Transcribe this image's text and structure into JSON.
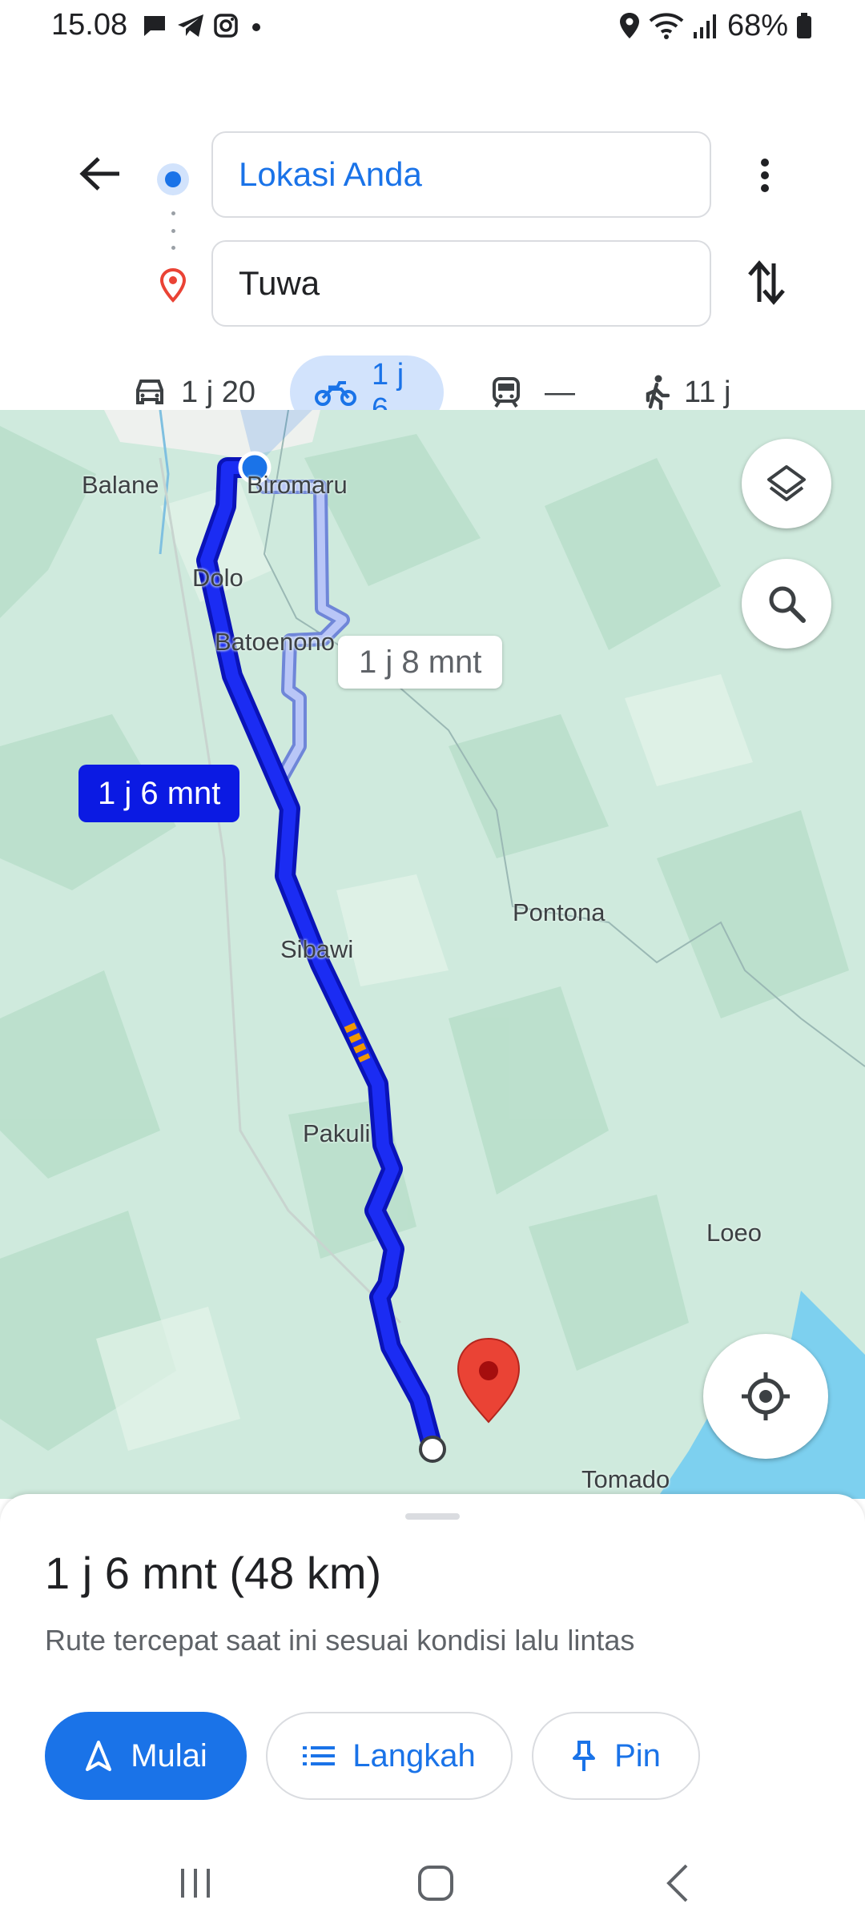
{
  "status_bar": {
    "time": "15.08",
    "notification_icons": [
      "chat-bubble-icon",
      "telegram-icon",
      "instagram-icon",
      "more-dot-icon"
    ],
    "system_icons": [
      "location-icon",
      "wifi-icon",
      "signal-icon",
      "battery-icon"
    ],
    "battery_text": "68%"
  },
  "header": {
    "origin_value": "Lokasi Anda",
    "destination_value": "Tuwa"
  },
  "modes": [
    {
      "icon": "car-icon",
      "label": "1 j 20",
      "selected": false
    },
    {
      "icon": "motorcycle-icon",
      "label": "1 j 6",
      "selected": true
    },
    {
      "icon": "train-icon",
      "label": "—",
      "selected": false
    },
    {
      "icon": "walk-icon",
      "label": "11 j",
      "selected": false
    }
  ],
  "map": {
    "places": [
      "Balane",
      "Biromaru",
      "Dolo",
      "Batoenono",
      "Pontona",
      "Sibawi",
      "Pakuli",
      "Loeo",
      "Tomado"
    ],
    "main_route_time": "1 j 6 mnt",
    "alt_route_time": "1 j 8 mnt",
    "colors": {
      "main_route": "#0b1ae3",
      "alt_route": "#a9b8f5",
      "land": "#cfeadd",
      "water": "#7dd0ef",
      "pin": "#ea4335"
    }
  },
  "sheet": {
    "summary": "1 j 6 mnt (48 km)",
    "description": "Rute tercepat saat ini sesuai kondisi lalu lintas",
    "start_label": "Mulai",
    "steps_label": "Langkah",
    "pin_label": "Pin"
  }
}
